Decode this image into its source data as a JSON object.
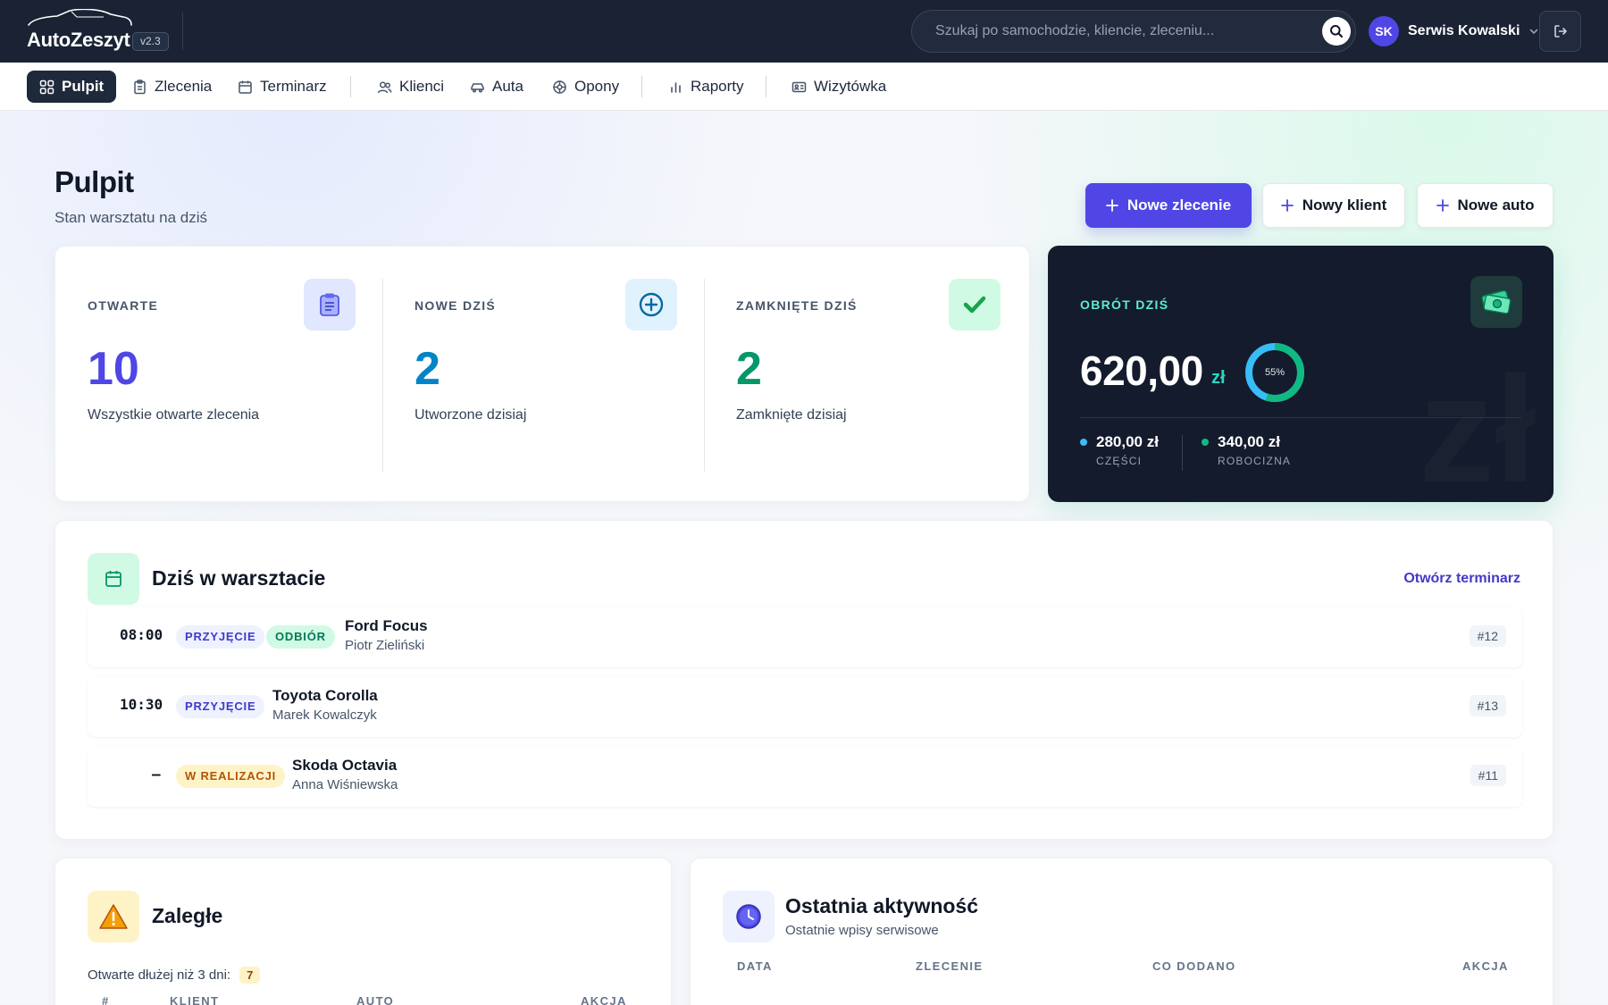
{
  "app": {
    "name": "AutoZeszyt",
    "version": "v2.3"
  },
  "search": {
    "placeholder": "Szukaj po samochodzie, kliencie, zleceniu..."
  },
  "user": {
    "initials": "SK",
    "name": "Serwis Kowalski"
  },
  "nav": {
    "items": [
      {
        "label": "Pulpit",
        "icon": "grid-icon",
        "active": true
      },
      {
        "label": "Zlecenia",
        "icon": "clipboard-icon"
      },
      {
        "label": "Terminarz",
        "icon": "calendar-icon"
      },
      {
        "label": "Klienci",
        "icon": "users-icon"
      },
      {
        "label": "Auta",
        "icon": "car-icon"
      },
      {
        "label": "Opony",
        "icon": "tire-icon"
      },
      {
        "label": "Raporty",
        "icon": "bar-chart-icon"
      },
      {
        "label": "Wizytówka",
        "icon": "id-card-icon"
      }
    ]
  },
  "page": {
    "title": "Pulpit",
    "subtitle": "Stan warsztatu na dziś"
  },
  "actions": {
    "new_order": "Nowe zlecenie",
    "new_client": "Nowy klient",
    "new_car": "Nowe auto"
  },
  "stats": {
    "open": {
      "label": "OTWARTE",
      "value": "10",
      "desc": "Wszystkie otwarte zlecenia",
      "color": "#4f46e5"
    },
    "new_today": {
      "label": "NOWE DZIŚ",
      "value": "2",
      "desc": "Utworzone dzisiaj",
      "color": "#0284c7"
    },
    "closed_today": {
      "label": "ZAMKNIĘTE DZIŚ",
      "value": "2",
      "desc": "Zamknięte dzisiaj",
      "color": "#059669"
    }
  },
  "revenue": {
    "label": "OBRÓT DZIŚ",
    "value": "620,00",
    "currency": "zł",
    "watermark": "zł",
    "donut_percent_label": "55%",
    "donut_fraction": 0.55,
    "parts": {
      "amount": "280,00 zł",
      "label": "CZĘŚCI",
      "color": "#38bdf8"
    },
    "labor": {
      "amount": "340,00 zł",
      "label": "ROBOCIZNA",
      "color": "#10b981"
    }
  },
  "today": {
    "title": "Dziś w warsztacie",
    "link": "Otwórz terminarz",
    "appointments": [
      {
        "time": "08:00",
        "tags": [
          "PRZYJĘCIE",
          "ODBIÓR"
        ],
        "car": "Ford Focus",
        "client": "Piotr Zieliński",
        "id": "#12"
      },
      {
        "time": "10:30",
        "tags": [
          "PRZYJĘCIE"
        ],
        "car": "Toyota Corolla",
        "client": "Marek Kowalczyk",
        "id": "#13"
      },
      {
        "time": "–",
        "tags": [
          "W REALIZACJI"
        ],
        "car": "Skoda Octavia",
        "client": "Anna Wiśniewska",
        "id": "#11"
      }
    ]
  },
  "overdue": {
    "title": "Zaległe",
    "note": "Otwarte dłużej niż 3 dni:",
    "count": "7",
    "columns": [
      "#",
      "KLIENT",
      "AUTO",
      "AKCJA"
    ]
  },
  "activity": {
    "title": "Ostatnia aktywność",
    "subtitle": "Ostatnie wpisy serwisowe",
    "columns": [
      "DATA",
      "ZLECENIE",
      "CO DODANO",
      "AKCJA"
    ]
  }
}
